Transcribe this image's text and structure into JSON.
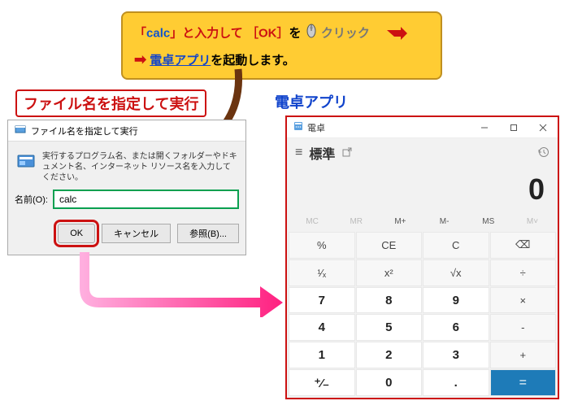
{
  "callout": {
    "line1_pre": "「",
    "line1_calc": "calc",
    "line1_mid": "」と入力して ",
    "line1_ok_open": "［",
    "line1_ok": "OK",
    "line1_ok_close": "］",
    "line1_wo": "を",
    "line1_click": "クリック",
    "line2_arrow": "➡",
    "line2_app": "電卓アプリ",
    "line2_tail": "を起動します。"
  },
  "labels": {
    "run": "ファイル名を指定して実行",
    "calc": "電卓アプリ"
  },
  "run_dialog": {
    "title": "ファイル名を指定して実行",
    "description": "実行するプログラム名、または開くフォルダーやドキュメント名、インターネット リソース名を入力してください。",
    "name_label": "名前(O):",
    "input_value": "calc",
    "ok": "OK",
    "cancel": "キャンセル",
    "browse": "参照(B)..."
  },
  "calc": {
    "title": "電卓",
    "mode": "標準",
    "display": "0",
    "mem": [
      "MC",
      "MR",
      "M+",
      "M-",
      "MS",
      "M˅"
    ],
    "keys": [
      "%",
      "CE",
      "C",
      "⌫",
      "¹⁄ₓ",
      "x²",
      "√x",
      "÷",
      "7",
      "8",
      "9",
      "×",
      "4",
      "5",
      "6",
      "-",
      "1",
      "2",
      "3",
      "+",
      "⁺⁄₋",
      "0",
      ".",
      "="
    ]
  }
}
